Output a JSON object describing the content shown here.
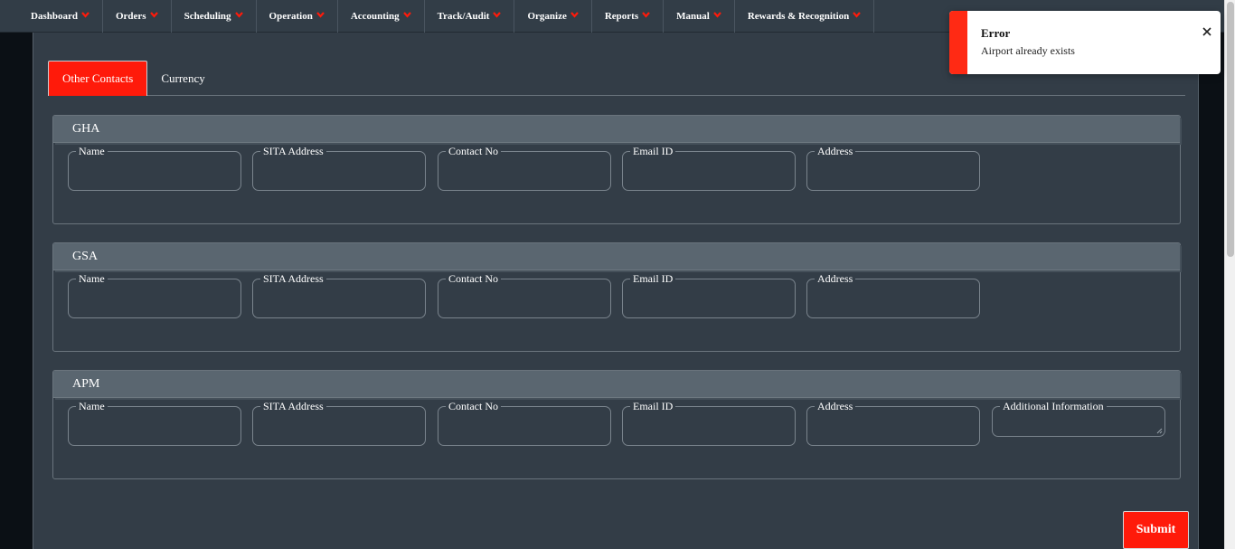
{
  "nav": {
    "items": [
      {
        "label": "Dashboard"
      },
      {
        "label": "Orders"
      },
      {
        "label": "Scheduling"
      },
      {
        "label": "Operation"
      },
      {
        "label": "Accounting"
      },
      {
        "label": "Track/Audit"
      },
      {
        "label": "Organize"
      },
      {
        "label": "Reports"
      },
      {
        "label": "Manual"
      },
      {
        "label": "Rewards & Recognition"
      }
    ],
    "chevron_icon": "chevron-down-icon",
    "chevron_color": "#ff1a0a"
  },
  "tabs": [
    {
      "label": "Other Contacts",
      "active": true
    },
    {
      "label": "Currency",
      "active": false
    }
  ],
  "sections": [
    {
      "title": "GHA",
      "fields": [
        "Name",
        "SITA Address",
        "Contact No",
        "Email ID",
        "Address"
      ]
    },
    {
      "title": "GSA",
      "fields": [
        "Name",
        "SITA Address",
        "Contact No",
        "Email ID",
        "Address"
      ]
    },
    {
      "title": "APM",
      "fields": [
        "Name",
        "SITA Address",
        "Contact No",
        "Email ID",
        "Address",
        "Additional Information"
      ]
    }
  ],
  "toast": {
    "title": "Error",
    "message": "Airport already exists",
    "close_icon": "close-icon",
    "accent": "#ff2a14"
  },
  "submit_label": "Submit",
  "colors": {
    "accent": "#ff1a0a",
    "panel": "#333d47",
    "section_header": "#5a6670"
  }
}
